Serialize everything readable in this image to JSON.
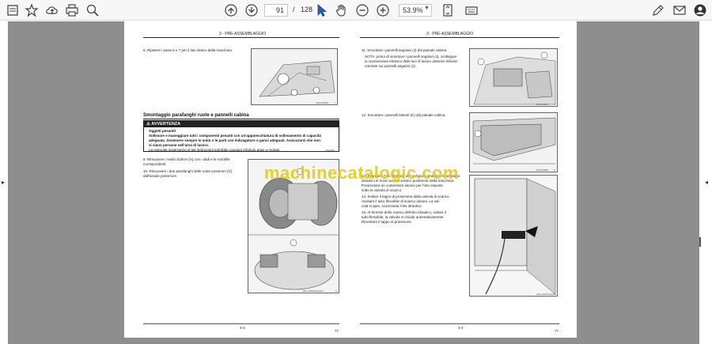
{
  "toolbar": {
    "page_current": "91",
    "page_sep": "/",
    "page_total": "128",
    "zoom": "53.9%",
    "icons": [
      "star-icon",
      "cloud-upload-icon",
      "print-icon",
      "zoom-search-icon",
      "page-up-icon",
      "page-down-icon",
      "pointer-icon",
      "hand-icon",
      "zoom-out-icon",
      "zoom-in-icon",
      "fit-page-icon",
      "keyboard-icon",
      "sign-icon",
      "mail-icon",
      "account-icon"
    ]
  },
  "watermark": "machinecatalogic.com",
  "left_page": {
    "header": "3 - PRE-ASSEMBLAGGIO",
    "step8": "8.   Ripetere i passi 6 e 7 per il lato destro della macchina.",
    "section_title": "Smontaggio parafanghi ruote e pannelli cabina",
    "warning_title": "AVVERTENZA",
    "warning_lines": [
      "Oggetti pesanti!",
      "Sollevare e maneggiare tutti i componenti pesanti con un'apparecchiatura di sollevamento di capacità",
      "adeguata. Sostenere sempre le unità o le parti con imbragature o ganci adeguati. Assicurarsi che non",
      "vi siano persone nell'area di lavoro.",
      "La mancata osservanza di tali indicazioni potrebbe causare infortuni gravi o mortali."
    ],
    "warning_code": "M1404A",
    "step9_lines": [
      "9.   Rimuovere i sedici bulloni (H) con i dadi e le rondelle",
      "     corrispondenti."
    ],
    "step10_lines": [
      "10.  Rimuovere i due parafanghi delle ruote posteriori (G)",
      "     dall'assale posteriore."
    ],
    "fig1_code": "BAIL03B10",
    "fig2_code": "LEIL14WI004F2A01",
    "fig1_num": "7",
    "fig2_num": "8",
    "footer": "3-3",
    "footer_right": "77"
  },
  "right_page": {
    "header": "3 - PRE-ASSEMBLAGGIO",
    "step11": "11.  Smontare i pannelli angolari (J) dal pianale cabina.",
    "note_lines": [
      "NOTA: prima di smontare i pannelli angolari (J), scollegare",
      "la connessione elettrica delle luci di lavoro anteriori inferiori",
      "montate sui pannelli angolari (J)."
    ],
    "step12": "12.  Smontare i pannelli laterali (K) dal pianale cabina.",
    "step13_lines": [
      "13.  Scaricare l'olio idraulico dal serbatoio idraulico. Il serbatoio",
      "     idraulico si trova sul lato sinistro posteriore della macchina.",
      "     Posizionare un contenitore idoneo per l'olio esausto",
      "     sotto la valvola di scarico."
    ],
    "step14_lines": [
      "14.  Svitare il tappo di protezione dalla valvola di scarico.",
      "     Avvitare il tubo flessibile di scarico idoneo. La val-",
      "     vola si apre, scaricando l'olio idraulico."
    ],
    "step15_lines": [
      "15.  Al termine dello scarico dell'olio idraulico, svitare il",
      "     tubo flessibile, la valvola si chiude automaticamente.",
      "     Riavvitare il tappo di protezione."
    ],
    "fig1_code": "BAIL09B01",
    "fig2_code": "BAIL09B02",
    "fig3_code": "LEIL16WI001A01",
    "fig1_num": "7",
    "fig2_num": "8",
    "fig3_num": "9",
    "footer": "3-4",
    "footer_right": "77"
  }
}
